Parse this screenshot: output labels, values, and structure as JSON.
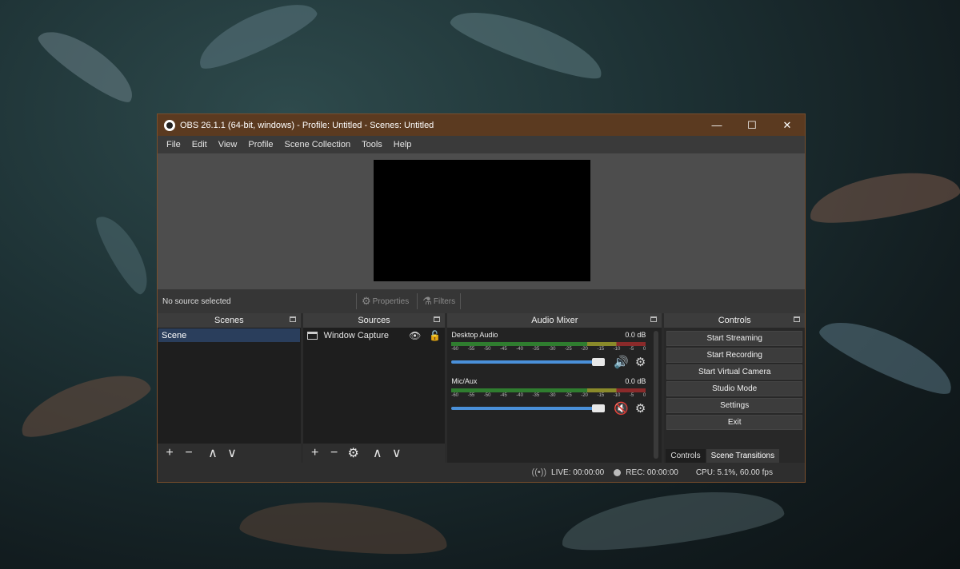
{
  "window": {
    "title": "OBS 26.1.1 (64-bit, windows) - Profile: Untitled - Scenes: Untitled",
    "controls": [
      "—",
      "☐",
      "✕"
    ]
  },
  "menu": [
    "File",
    "Edit",
    "View",
    "Profile",
    "Scene Collection",
    "Tools",
    "Help"
  ],
  "source_bar": {
    "status": "No source selected",
    "properties": "Properties",
    "filters": "Filters"
  },
  "scenes": {
    "title": "Scenes",
    "items": [
      "Scene"
    ],
    "footer": [
      "+",
      "−",
      "∧",
      "∨"
    ]
  },
  "sources": {
    "title": "Sources",
    "items": [
      {
        "name": "Window Capture"
      }
    ],
    "footer": [
      "+",
      "−",
      "⚙",
      "∧",
      "∨"
    ]
  },
  "mixer": {
    "title": "Audio Mixer",
    "ticks": [
      "-60",
      "-55",
      "-50",
      "-45",
      "-40",
      "-35",
      "-30",
      "-25",
      "-20",
      "-15",
      "-10",
      "-5",
      "0"
    ],
    "channels": [
      {
        "name": "Desktop Audio",
        "db": "0.0 dB",
        "muted": false,
        "volume": 1.0
      },
      {
        "name": "Mic/Aux",
        "db": "0.0 dB",
        "muted": true,
        "volume": 1.0
      }
    ]
  },
  "controls": {
    "title": "Controls",
    "buttons": [
      "Start Streaming",
      "Start Recording",
      "Start Virtual Camera",
      "Studio Mode",
      "Settings",
      "Exit"
    ],
    "tabs": [
      "Controls",
      "Scene Transitions"
    ]
  },
  "status": {
    "live": "LIVE: 00:00:00",
    "rec": "REC: 00:00:00",
    "cpu": "CPU: 5.1%, 60.00 fps"
  },
  "colors": {
    "titlebar": "#5b3a20",
    "scene_selected": "#2a3e5c",
    "fader": "#4a90d9",
    "mute": "#e03030"
  }
}
